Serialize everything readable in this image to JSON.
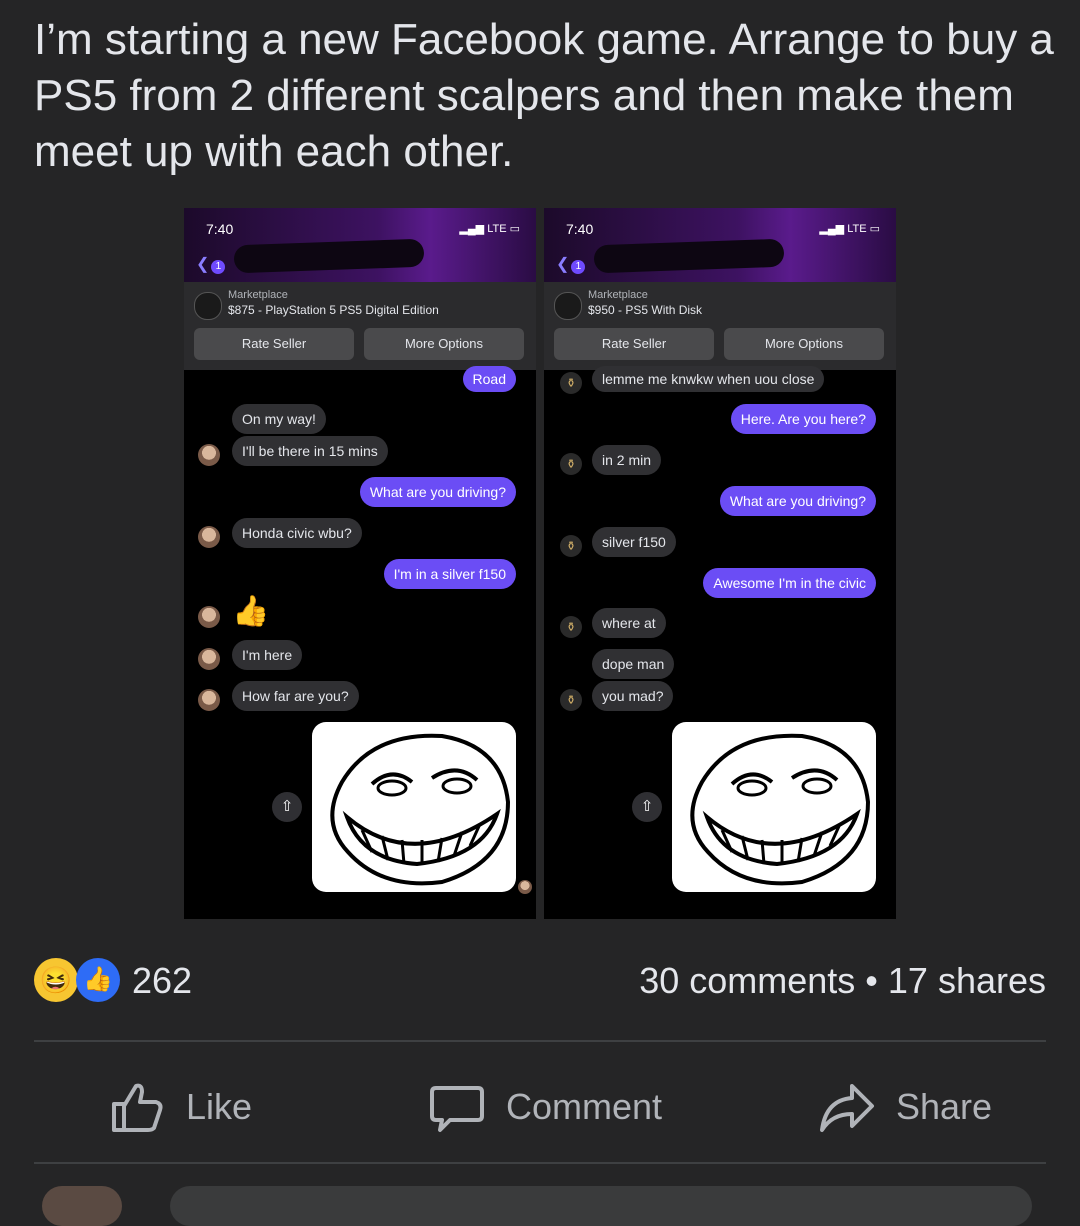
{
  "post": {
    "text": "I’m starting a new Facebook game. Arrange to buy a PS5 from 2 different scalpers and then make them meet up with each other."
  },
  "left_phone": {
    "time": "7:40",
    "signal": "LTE",
    "back_badge": "1",
    "marketplace_label": "Marketplace",
    "item": "$875 - PlayStation 5 PS5 Digital Edition",
    "rate_seller": "Rate Seller",
    "more_options": "More Options",
    "messages": [
      {
        "text": "Road",
        "side": "sent"
      },
      {
        "text": "On my way!",
        "side": "recv"
      },
      {
        "text": "I'll be there in 15 mins",
        "side": "recv"
      },
      {
        "text": "What are you driving?",
        "side": "sent"
      },
      {
        "text": "Honda civic wbu?",
        "side": "recv"
      },
      {
        "text": "I'm in a silver f150",
        "side": "sent"
      },
      {
        "text": "I'm here",
        "side": "recv"
      },
      {
        "text": "How far are you?",
        "side": "recv"
      }
    ]
  },
  "right_phone": {
    "time": "7:40",
    "signal": "LTE",
    "back_badge": "1",
    "marketplace_label": "Marketplace",
    "item": "$950 - PS5 With Disk",
    "rate_seller": "Rate Seller",
    "more_options": "More Options",
    "messages": [
      {
        "text": "lemme me knwkw when uou close",
        "side": "recv"
      },
      {
        "text": "Here. Are you here?",
        "side": "sent"
      },
      {
        "text": "in 2 min",
        "side": "recv"
      },
      {
        "text": "What are you driving?",
        "side": "sent"
      },
      {
        "text": "silver f150",
        "side": "recv"
      },
      {
        "text": "Awesome I'm in the civic",
        "side": "sent"
      },
      {
        "text": "where at",
        "side": "recv"
      },
      {
        "text": "dope man",
        "side": "recv"
      },
      {
        "text": "you mad?",
        "side": "recv"
      }
    ]
  },
  "reactions": {
    "count": "262",
    "icons": [
      "laugh-emoji",
      "like-emoji"
    ]
  },
  "meta": {
    "text": "30 comments • 17 shares"
  },
  "actions": {
    "like": "Like",
    "comment": "Comment",
    "share": "Share"
  },
  "colors": {
    "background": "#252526",
    "sent_bubble": "#6b4df5",
    "recv_bubble": "#303033",
    "like_blue": "#2e6cf6"
  }
}
